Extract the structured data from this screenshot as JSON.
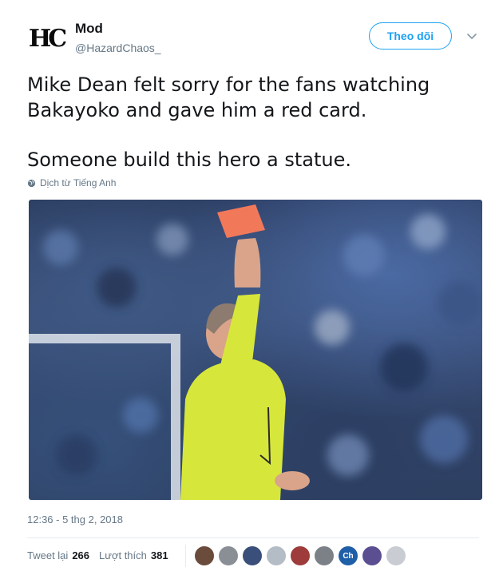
{
  "author": {
    "avatar_text": "HC",
    "name": "Mod",
    "handle": "@HazardChaos_"
  },
  "follow_button": {
    "label": "Theo dõi"
  },
  "menu": {
    "icon": "chevron-down-icon"
  },
  "tweet": {
    "lines": [
      "Mike Dean felt sorry for the fans watching Bakayoko and gave him a red card.",
      "Someone build this hero a statue."
    ],
    "translate_label": "Dịch từ Tiếng Anh"
  },
  "timestamp": "12:36 - 5 thg 2, 2018",
  "stats": {
    "retweets_label": "Tweet lại",
    "retweets_count": "266",
    "likes_label": "Lượt thích",
    "likes_count": "381"
  },
  "likers": [
    {
      "color": "#6a4b3c"
    },
    {
      "color": "#8a8f96"
    },
    {
      "color": "#3a4f7a"
    },
    {
      "color": "#b4bcc6"
    },
    {
      "color": "#9e3b3b"
    },
    {
      "color": "#7c8087"
    },
    {
      "color": "#1f5fa8",
      "text": "Ch"
    },
    {
      "color": "#5b4f92"
    },
    {
      "color": "#c9cdd3"
    }
  ],
  "colors": {
    "accent": "#1da1f2",
    "text": "#14171a",
    "secondary": "#657786"
  }
}
